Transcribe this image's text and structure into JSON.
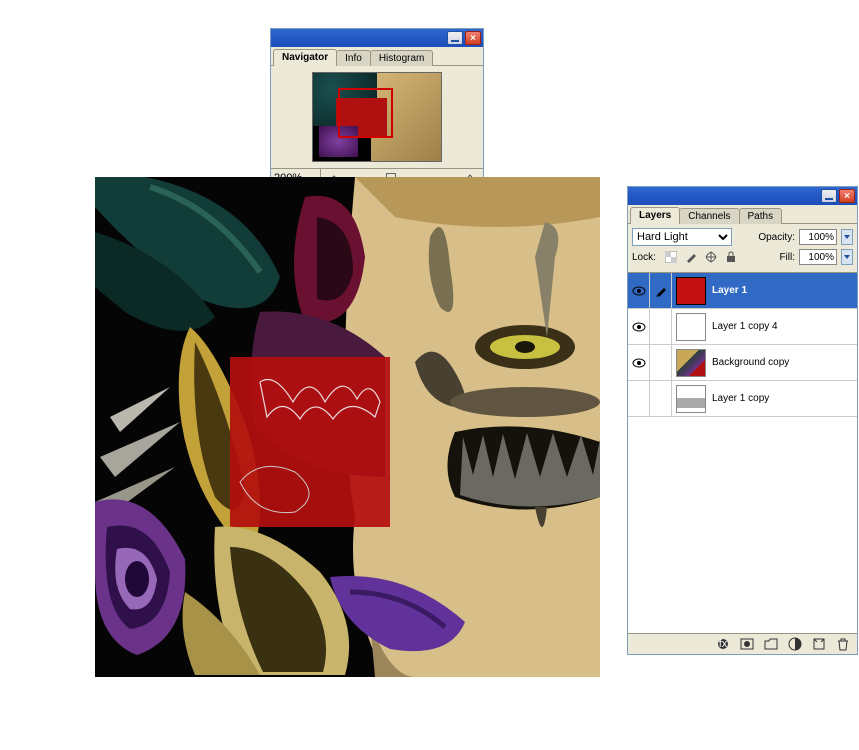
{
  "navigator": {
    "tabs": [
      "Navigator",
      "Info",
      "Histogram"
    ],
    "activeTab": 0,
    "zoom": "200%"
  },
  "layers": {
    "tabs": [
      "Layers",
      "Channels",
      "Paths"
    ],
    "activeTab": 0,
    "blendMode": "Hard Light",
    "opacityLabel": "Opacity:",
    "opacityValue": "100%",
    "lockLabel": "Lock:",
    "fillLabel": "Fill:",
    "fillValue": "100%",
    "items": [
      {
        "name": "Layer 1",
        "visible": true,
        "selected": true,
        "thumb": "red",
        "linked": "brush"
      },
      {
        "name": "Layer 1 copy 4",
        "visible": true,
        "selected": false,
        "thumb": "checker",
        "linked": ""
      },
      {
        "name": "Background copy",
        "visible": true,
        "selected": false,
        "thumb": "art",
        "linked": ""
      },
      {
        "name": "Layer 1 copy",
        "visible": false,
        "selected": false,
        "thumb": "gray",
        "linked": ""
      }
    ]
  }
}
